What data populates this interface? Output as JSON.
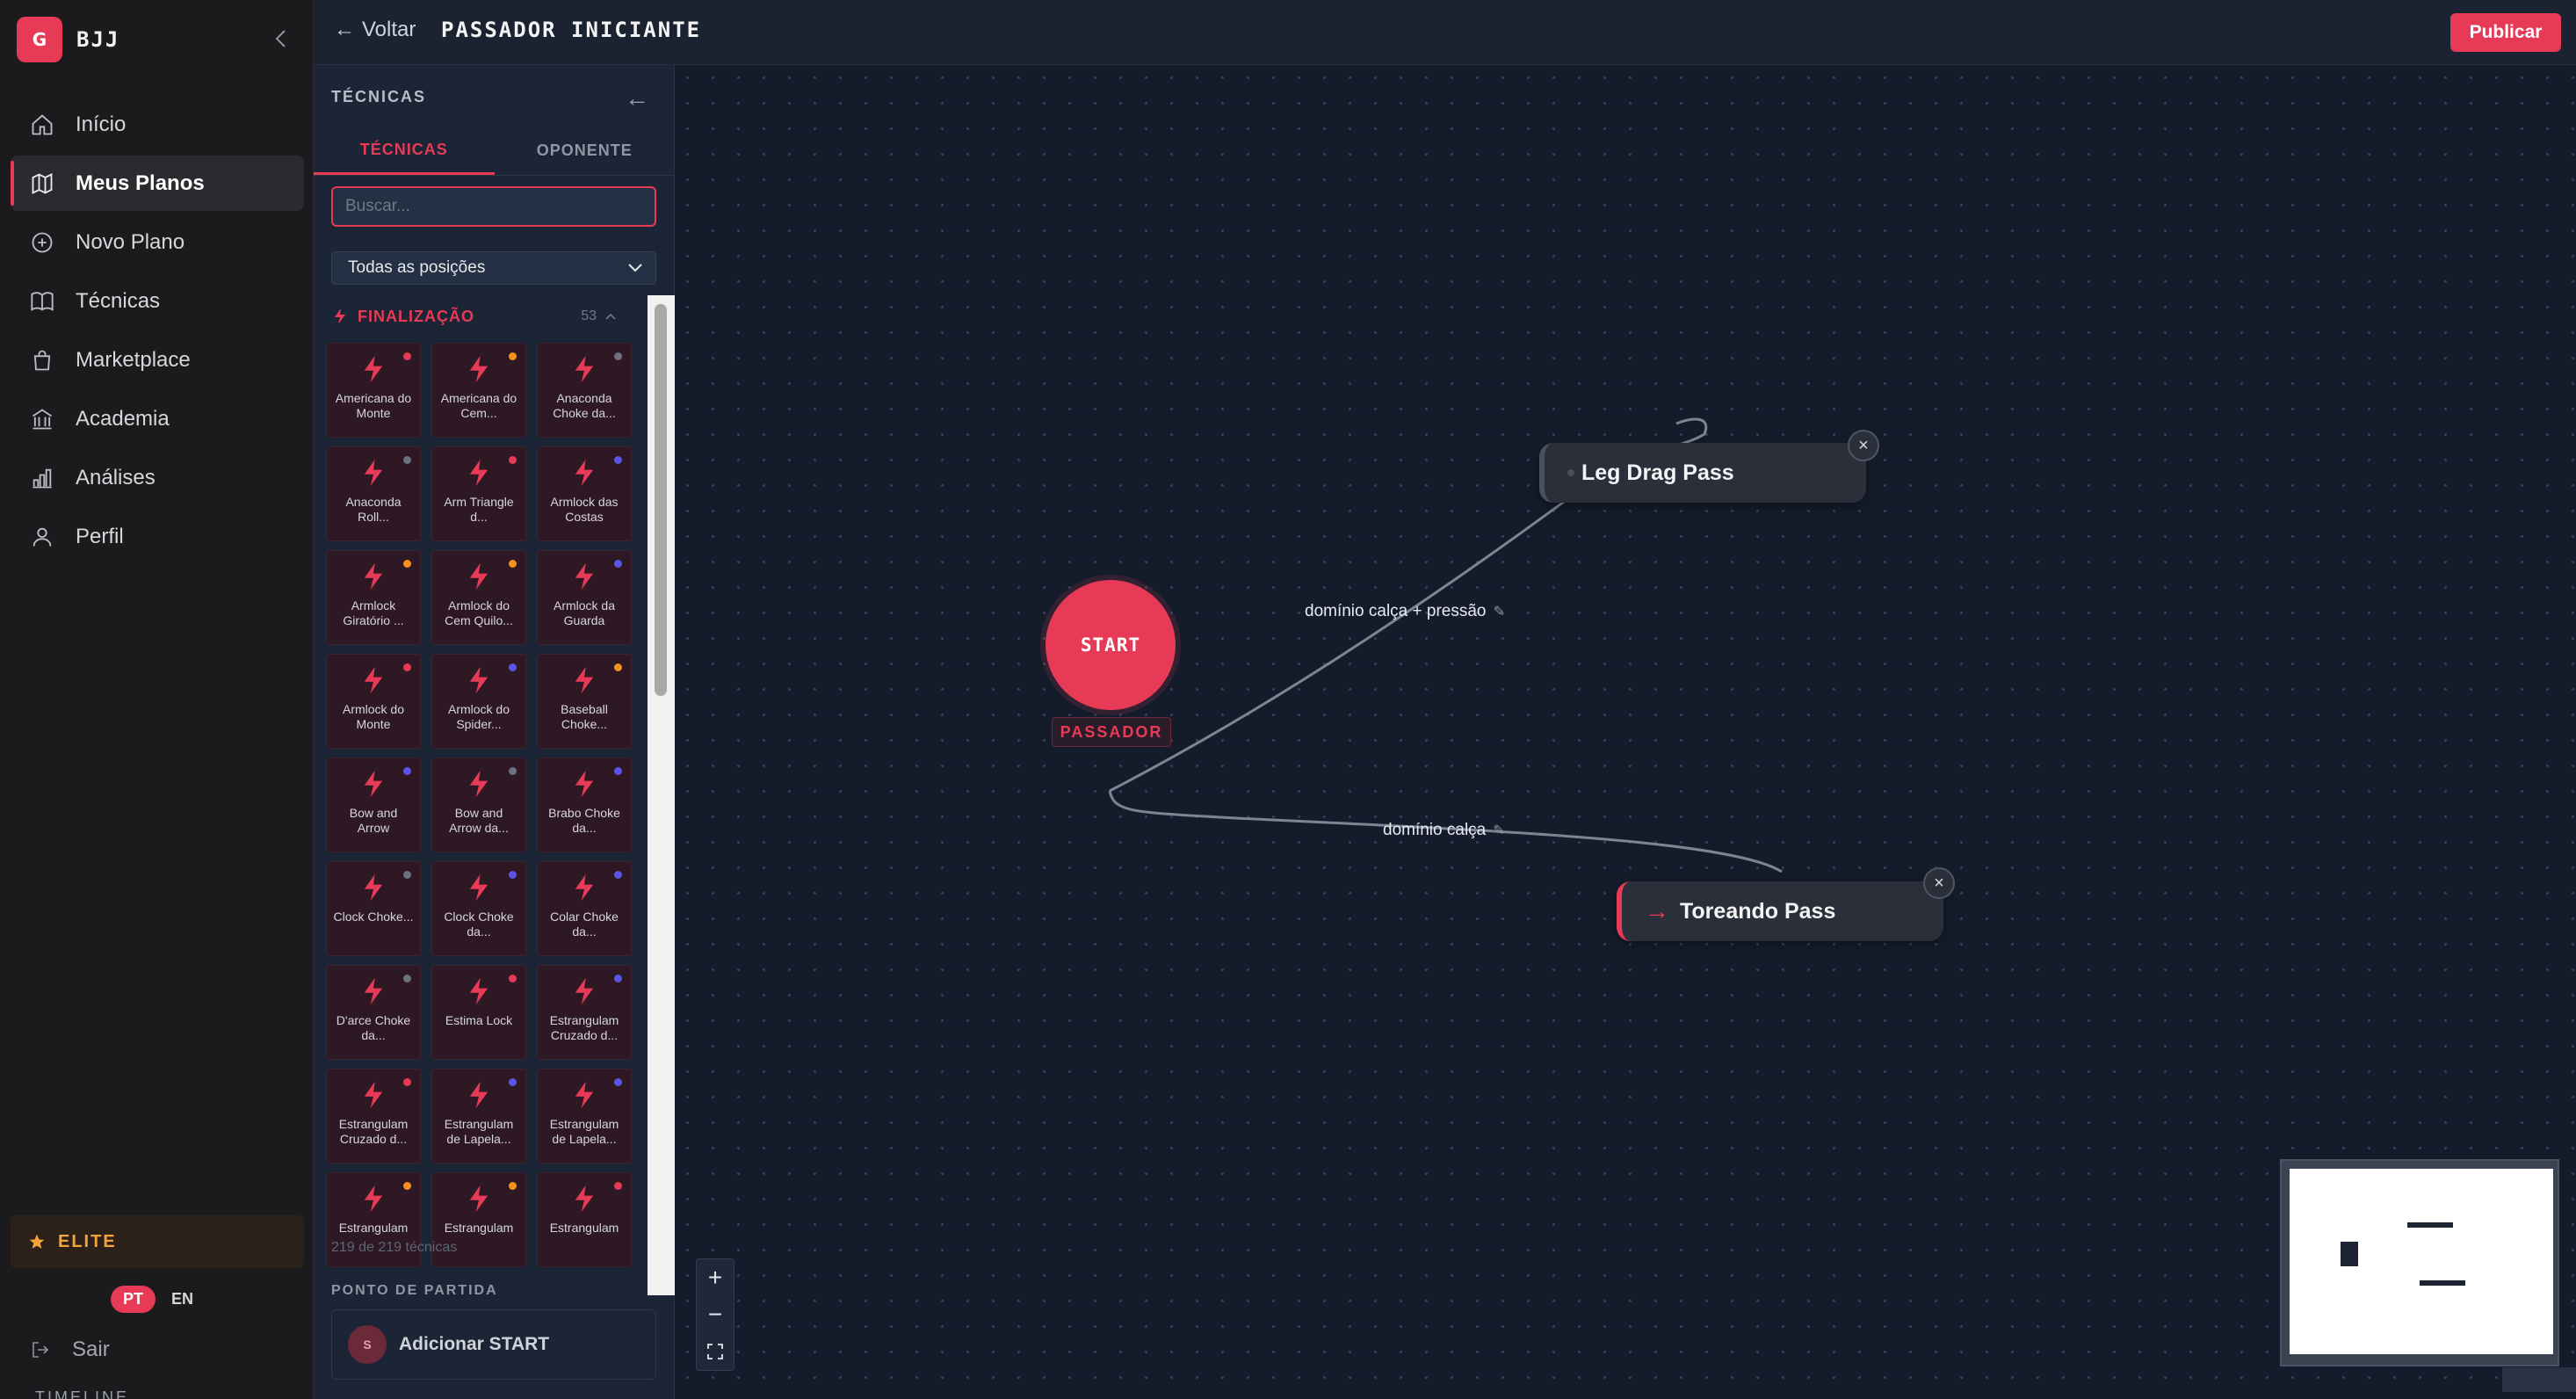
{
  "brand": {
    "logo_letter": "G",
    "name": "BJJ"
  },
  "sidebar": {
    "items": [
      {
        "label": "Início",
        "icon": "home-icon",
        "active": false
      },
      {
        "label": "Meus Planos",
        "icon": "map-icon",
        "active": true
      },
      {
        "label": "Novo Plano",
        "icon": "plus-circle-icon",
        "active": false
      },
      {
        "label": "Técnicas",
        "icon": "book-icon",
        "active": false
      },
      {
        "label": "Marketplace",
        "icon": "shopping-bag-icon",
        "active": false
      },
      {
        "label": "Academia",
        "icon": "building-icon",
        "active": false
      },
      {
        "label": "Análises",
        "icon": "bar-chart-icon",
        "active": false
      },
      {
        "label": "Perfil",
        "icon": "user-icon",
        "active": false
      }
    ],
    "elite_label": "ELITE",
    "lang_pt": "PT",
    "lang_en": "EN",
    "logout_label": "Sair"
  },
  "topbar": {
    "back_label": "Voltar",
    "title": "PASSADOR INICIANTE",
    "publish_label": "Publicar"
  },
  "panel": {
    "title": "TÉCNICAS",
    "tabs": [
      {
        "label": "TÉCNICAS",
        "active": true
      },
      {
        "label": "OPONENTE",
        "active": false
      }
    ],
    "search_placeholder": "Buscar...",
    "position_filter": "Todas as posições",
    "category": {
      "name": "FINALIZAÇÃO",
      "count": "53"
    },
    "techniques": [
      {
        "label": "Americana do Monte",
        "dot": "#e63a57"
      },
      {
        "label": "Americana do Cem...",
        "dot": "#f5901e"
      },
      {
        "label": "Anaconda Choke da...",
        "dot": "#6b7280"
      },
      {
        "label": "Anaconda Roll...",
        "dot": "#6b7280"
      },
      {
        "label": "Arm Triangle d...",
        "dot": "#e63a57"
      },
      {
        "label": "Armlock das Costas",
        "dot": "#5b54e8"
      },
      {
        "label": "Armlock Giratório ...",
        "dot": "#f5901e"
      },
      {
        "label": "Armlock do Cem Quilo...",
        "dot": "#f5901e"
      },
      {
        "label": "Armlock da Guarda",
        "dot": "#5b54e8"
      },
      {
        "label": "Armlock do Monte",
        "dot": "#e63a57"
      },
      {
        "label": "Armlock do Spider...",
        "dot": "#5b54e8"
      },
      {
        "label": "Baseball Choke...",
        "dot": "#f5901e"
      },
      {
        "label": "Bow and Arrow",
        "dot": "#5b54e8"
      },
      {
        "label": "Bow and Arrow da...",
        "dot": "#6b7280"
      },
      {
        "label": "Brabo Choke da...",
        "dot": "#5b54e8"
      },
      {
        "label": "Clock Choke...",
        "dot": "#6b7280"
      },
      {
        "label": "Clock Choke da...",
        "dot": "#5b54e8"
      },
      {
        "label": "Colar Choke da...",
        "dot": "#5b54e8"
      },
      {
        "label": "D'arce Choke da...",
        "dot": "#6b7280"
      },
      {
        "label": "Estima Lock",
        "dot": "#e63a57"
      },
      {
        "label": "Estrangulam Cruzado d...",
        "dot": "#5b54e8"
      },
      {
        "label": "Estrangulam Cruzado d...",
        "dot": "#e63a57"
      },
      {
        "label": "Estrangulam de Lapela...",
        "dot": "#5b54e8"
      },
      {
        "label": "Estrangulam de Lapela...",
        "dot": "#5b54e8"
      },
      {
        "label": "Estrangulam",
        "dot": "#f5901e"
      },
      {
        "label": "Estrangulam",
        "dot": "#f5901e"
      },
      {
        "label": "Estrangulam",
        "dot": "#e63a57"
      }
    ],
    "count_text": "219 de 219 técnicas",
    "start_section_title": "PONTO DE PARTIDA",
    "add_start_avatar": "S",
    "add_start_label": "Adicionar START"
  },
  "canvas": {
    "start_label": "START",
    "start_role": "PASSADOR",
    "nodes": [
      {
        "label": "Leg Drag Pass"
      },
      {
        "label": "Toreando Pass",
        "prefix": "→"
      }
    ],
    "edges": [
      {
        "label": "domínio calça + pressão"
      },
      {
        "label": "domínio calça"
      }
    ],
    "close_glyph": "×",
    "zoom": {
      "in": "+",
      "out": "−",
      "fit": "⛶"
    }
  },
  "colors": {
    "accent": "#e63a57",
    "elite": "#f2a33b",
    "canvas_bg": "#141c2b"
  },
  "bottom_peek": "TIMELINE"
}
